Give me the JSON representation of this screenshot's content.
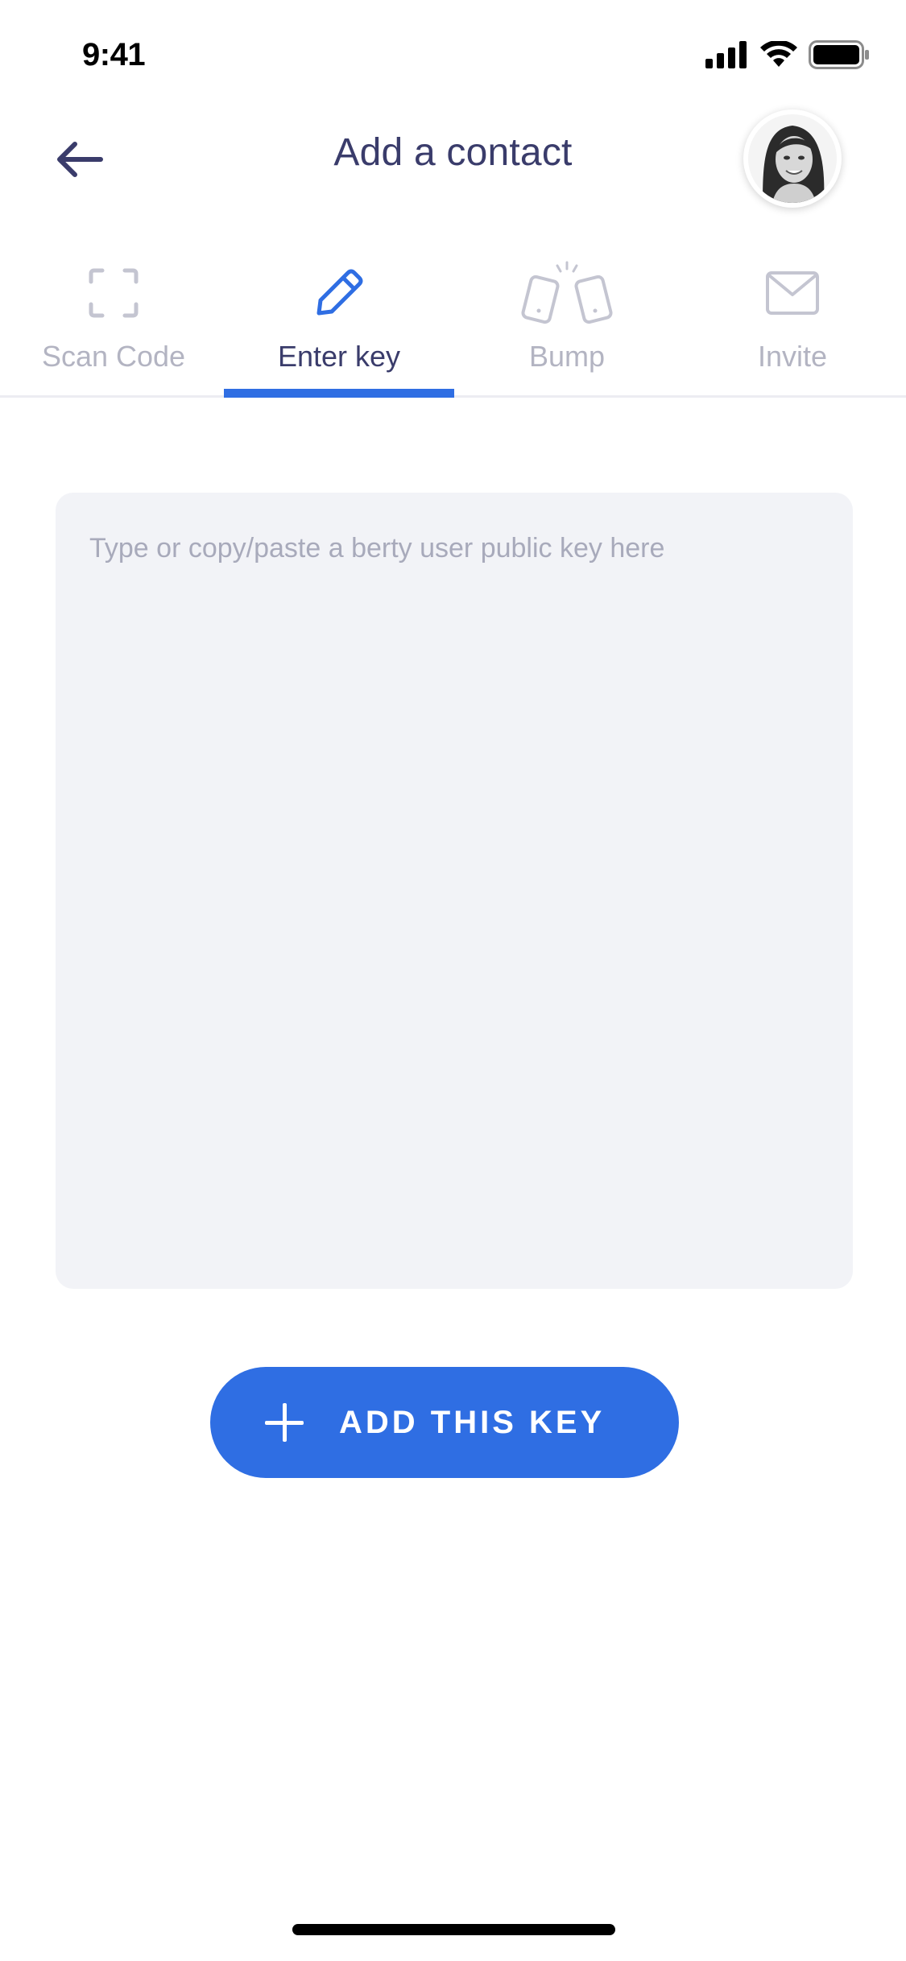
{
  "status_bar": {
    "time": "9:41"
  },
  "header": {
    "title": "Add a contact",
    "back_icon": "arrow-left-icon",
    "avatar": "user-avatar"
  },
  "tabs": [
    {
      "label": "Scan Code",
      "icon": "scan-frame-icon",
      "active": false
    },
    {
      "label": "Enter key",
      "icon": "pencil-icon",
      "active": true
    },
    {
      "label": "Bump",
      "icon": "bump-phones-icon",
      "active": false
    },
    {
      "label": "Invite",
      "icon": "envelope-icon",
      "active": false
    }
  ],
  "key_input": {
    "placeholder": "Type or copy/paste a berty user public key here",
    "value": ""
  },
  "add_button": {
    "label": "ADD THIS KEY",
    "icon": "plus-icon"
  },
  "colors": {
    "accent": "#2f6ee3",
    "title_text": "#3a3c6b",
    "inactive_text": "#b3b4c2",
    "input_background": "#f2f3f7"
  }
}
